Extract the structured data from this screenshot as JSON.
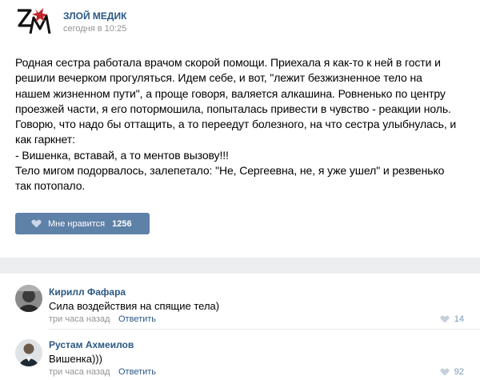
{
  "post": {
    "author": "ЗЛОЙ МЕДИК",
    "time": "сегодня в 10:25",
    "avatar_icon": "zm-logo-icon",
    "text": "Родная сестра работала врачом скорой помощи. Приехала я как-то к ней в гости и\nрешили вечерком прогуляться. Идем себе, и вот, \"лежит безжизненное тело на\nнашем жизненном пути\", а проще говоря, валяется алкашина. Ровненько по центру\nпроезжей части, я его потормошила, попыталась привести в чувство - реакции ноль.\nГоворю, что надо бы оттащить, а то переедут болезного, на что сестра улыбнулась, и\nкак гаркнет:\n- Вишенка, вставай, а то ментов вызову!!!\nТело мигом подорвалось, залепетало: \"Не, Сергеевна, не, я уже ушел\" и резвенько\nтак потопало.",
    "like_label": "Мне нравится",
    "like_count": "1256"
  },
  "comments": [
    {
      "name": "Кирилл Фафара",
      "text": "Сила воздействия на спящие тела)",
      "time": "три часа назад",
      "reply": "Ответить",
      "likes": "14"
    },
    {
      "name": "Рустам Ахмеилов",
      "text": "Вишенка)))",
      "time": "три часа назад",
      "reply": "Ответить",
      "likes": "92"
    }
  ],
  "colors": {
    "link": "#2a5885",
    "button": "#5e81a8",
    "muted": "#939393",
    "separator": "#edeef0",
    "logo_red": "#c0272d"
  }
}
